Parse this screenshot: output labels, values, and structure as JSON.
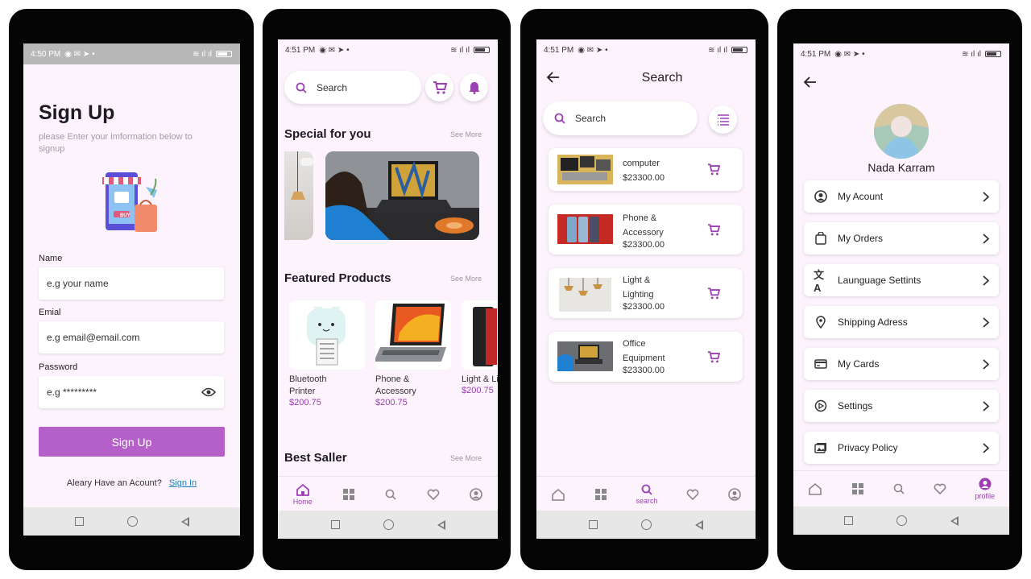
{
  "status": {
    "s1_time": "4:50 PM",
    "s2_time": "4:51 PM",
    "s3_time": "4:51 PM",
    "s4_time": "4:51 PM"
  },
  "signup": {
    "title": "Sign Up",
    "subtitle": "please Enter your imformation below to signup",
    "promo_badge": "BUY",
    "name_label": "Name",
    "name_placeholder": "e.g your name",
    "email_label": "Emial",
    "email_placeholder": "e.g email@email.com",
    "password_label": "Password",
    "password_placeholder": "e.g *********",
    "submit_label": "Sign Up",
    "footer_text": "Aleary Have an Acount?",
    "signin_link": "Sign In"
  },
  "home": {
    "search_label": "Search",
    "special_title": "Special for you",
    "special_see_more": "See More",
    "featured_title": "Featured Products",
    "featured_see_more": "See More",
    "featured": [
      {
        "name": "Bluetooth Printer",
        "price": "$200.75"
      },
      {
        "name": "Phone & Accessory",
        "price": "$200.75"
      },
      {
        "name": "Light & Lighting",
        "price": "$200.75"
      }
    ],
    "best_title": "Best Saller",
    "best_see_more": "See More",
    "nav_home": "Home"
  },
  "search": {
    "title": "Search",
    "search_label": "Search",
    "results": [
      {
        "name": "computer",
        "price": "$23300.00"
      },
      {
        "name": "Phone & Accessory",
        "price": "$23300.00"
      },
      {
        "name": "Light & Lighting",
        "price": "$23300.00"
      },
      {
        "name": "Office Equipment",
        "price": "$23300.00"
      }
    ],
    "nav_search": "search"
  },
  "profile": {
    "name": "Nada Karram",
    "menu": [
      {
        "label": "My Acount",
        "icon": "account-circle-icon"
      },
      {
        "label": "My Orders",
        "icon": "shopping-bag-icon"
      },
      {
        "label": "Launguage Settints",
        "icon": "translate-icon"
      },
      {
        "label": "Shipping Adress",
        "icon": "location-pin-icon"
      },
      {
        "label": "My Cards",
        "icon": "credit-card-icon"
      },
      {
        "label": "Settings",
        "icon": "settings-icon"
      },
      {
        "label": "Privacy Policy",
        "icon": "privacy-icon"
      }
    ],
    "nav_profile": "profile"
  },
  "colors": {
    "accent": "#9c3fb3",
    "button": "#b460c8",
    "screen_bg": "#fcf3fd"
  }
}
